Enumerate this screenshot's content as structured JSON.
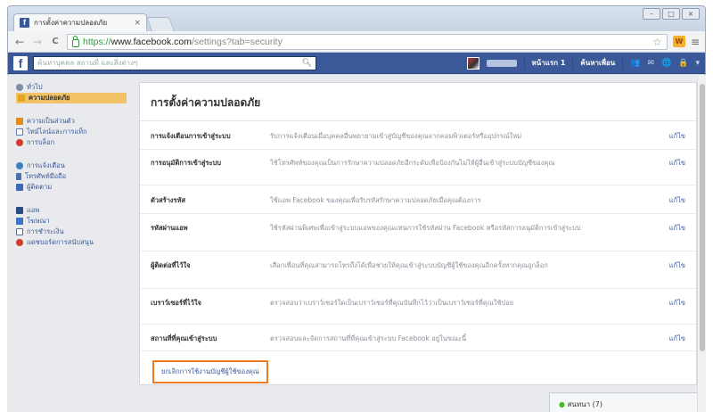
{
  "browser": {
    "tab_title": "การตั้งค่าความปลอดภัย",
    "tab_close": "×",
    "window_controls": [
      "–",
      "□",
      "×"
    ],
    "url_https": "https://",
    "url_host": "www.facebook.com",
    "url_path": "/settings?tab=security",
    "back_glyph": "←",
    "forward_glyph": "→",
    "reload_glyph": "C",
    "star_glyph": "☆",
    "ext_label": "W",
    "menu_glyph": "≡"
  },
  "fb": {
    "logo": "f",
    "search_placeholder": "ค้นหาบุคคล สถานที่ และสิ่งต่างๆ",
    "search_icon": "search-icon",
    "home": "หน้าแรก 1",
    "find_friends": "ค้นหาเพื่อน",
    "icons": [
      "friends-icon",
      "messages-icon",
      "notifications-icon",
      "lock-icon",
      "caret-down-icon"
    ],
    "icon_glyphs": [
      "👥",
      "✉",
      "🌐",
      "🔒",
      "▾"
    ]
  },
  "leftnav": {
    "groups": [
      [
        {
          "label": "ทั่วไป",
          "icon": "gear-icon",
          "active": false
        },
        {
          "label": "ความปลอดภัย",
          "icon": "lock-icon",
          "active": true
        }
      ],
      [
        {
          "label": "ความเป็นส่วนตัว",
          "icon": "privacy-icon",
          "active": false
        },
        {
          "label": "ไทม์ไลน์และการแท็ก",
          "icon": "timeline-icon",
          "active": false
        },
        {
          "label": "การบล็อก",
          "icon": "block-icon",
          "active": false
        }
      ],
      [
        {
          "label": "การแจ้งเตือน",
          "icon": "globe-icon",
          "active": false
        },
        {
          "label": "โทรศัพท์มือถือ",
          "icon": "phone-icon",
          "active": false
        },
        {
          "label": "ผู้ติดตาม",
          "icon": "followers-icon",
          "active": false
        }
      ],
      [
        {
          "label": "แอพ",
          "icon": "apps-icon",
          "active": false
        },
        {
          "label": "โฆษณา",
          "icon": "ads-icon",
          "active": false
        },
        {
          "label": "การชำระเงิน",
          "icon": "payments-icon",
          "active": false
        },
        {
          "label": "แดชบอร์ดการสนับสนุน",
          "icon": "support-icon",
          "active": false
        }
      ]
    ]
  },
  "panel": {
    "title": "การตั้งค่าความปลอดภัย",
    "rows": [
      {
        "label": "การแจ้งเตือนการเข้าสู่ระบบ",
        "desc": "รับการแจ้งเตือนเมื่อบุคคลอื่นพยายามเข้าสู่บัญชีของคุณจากคอมพิวเตอร์หรืออุปกรณ์ใหม่",
        "edit": "แก้ไข"
      },
      {
        "label": "การอนุมัติการเข้าสู่ระบบ",
        "desc": "ใช้โทรศัพท์ของคุณเป็นการรักษาความปลอดภัยอีกระดับเพื่อป้องกันไม่ให้ผู้อื่นเข้าสู่ระบบบัญชีของคุณ",
        "edit": "แก้ไข"
      },
      {
        "label": "ตัวสร้างรหัส",
        "desc": "ใช้แอพ Facebook ของคุณเพื่อรับรหัสรักษาความปลอดภัยเมื่อคุณต้องการ",
        "edit": "แก้ไข"
      },
      {
        "label": "รหัสผ่านแอพ",
        "desc": "ใช้รหัสผ่านพิเศษเพื่อเข้าสู่ระบบแอพของคุณแทนการใช้รหัสผ่าน Facebook หรือรหัสการอนุมัติการเข้าสู่ระบบ",
        "edit": "แก้ไข"
      },
      {
        "label": "ผู้ติดต่อที่ไว้ใจ",
        "desc": "เลือกเพื่อนที่คุณสามารถโทรถึงได้เพื่อช่วยให้คุณเข้าสู่ระบบบัญชีผู้ใช้ของคุณอีกครั้งหากคุณถูกล็อก",
        "edit": "แก้ไข"
      },
      {
        "label": "เบราว์เซอร์ที่ไว้ใจ",
        "desc": "ตรวจสอบว่าเบราว์เซอร์ใดเป็นเบราว์เซอร์ที่คุณบันทึกไว้ว่าเป็นเบราว์เซอร์ที่คุณใช้บ่อย",
        "edit": "แก้ไข"
      },
      {
        "label": "สถานที่ที่คุณเข้าสู่ระบบ",
        "desc": "ตรวจสอบและจัดการสถานที่ที่คุณเข้าสู่ระบบ Facebook อยู่ในขณะนี้",
        "edit": "แก้ไข"
      }
    ],
    "deactivate": "ยกเลิกการใช้งานบัญชีผู้ใช้ของคุณ"
  },
  "chat": {
    "label": "สนทนา (7)",
    "dot": "●"
  }
}
